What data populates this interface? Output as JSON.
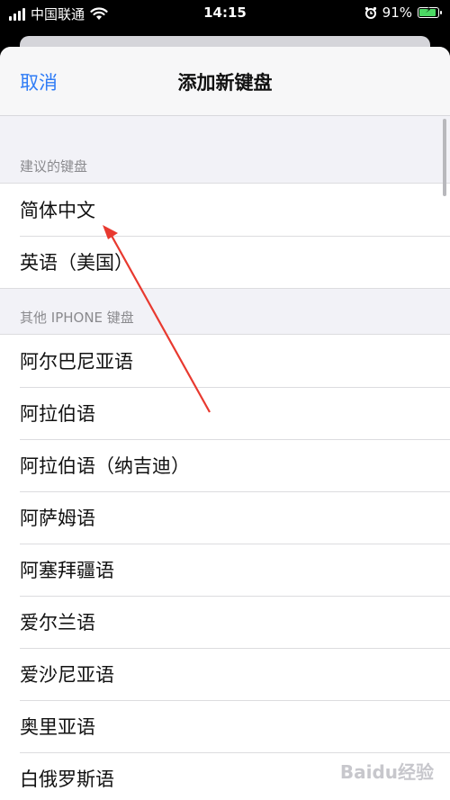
{
  "status_bar": {
    "carrier": "中国联通",
    "time": "14:15",
    "battery_percent": "91%",
    "battery_level": 0.91,
    "wifi_icon": "wifi-icon",
    "alarm_icon": "alarm-icon"
  },
  "nav": {
    "cancel_label": "取消",
    "title": "添加新键盘"
  },
  "sections": {
    "suggested": {
      "header": "建议的键盘",
      "items": [
        "简体中文",
        "英语（美国）"
      ]
    },
    "other": {
      "header": "其他 IPHONE 键盘",
      "items": [
        "阿尔巴尼亚语",
        "阿拉伯语",
        "阿拉伯语（纳吉迪）",
        "阿萨姆语",
        "阿塞拜疆语",
        "爱尔兰语",
        "爱沙尼亚语",
        "奥里亚语",
        "白俄罗斯语"
      ]
    }
  },
  "colors": {
    "accent": "#2f7cf6",
    "annotation": "#e8392f",
    "battery": "#4cd964"
  },
  "watermark": "Baidu经验"
}
